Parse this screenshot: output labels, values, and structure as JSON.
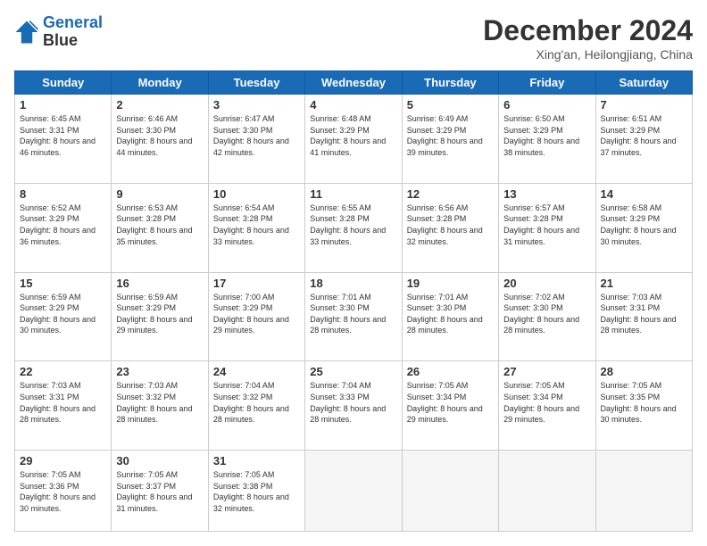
{
  "logo": {
    "line1": "General",
    "line2": "Blue"
  },
  "header": {
    "title": "December 2024",
    "subtitle": "Xing'an, Heilongjiang, China"
  },
  "weekdays": [
    "Sunday",
    "Monday",
    "Tuesday",
    "Wednesday",
    "Thursday",
    "Friday",
    "Saturday"
  ],
  "weeks": [
    [
      {
        "day": "1",
        "rise": "6:45 AM",
        "set": "3:31 PM",
        "daylight": "8 hours and 46 minutes."
      },
      {
        "day": "2",
        "rise": "6:46 AM",
        "set": "3:30 PM",
        "daylight": "8 hours and 44 minutes."
      },
      {
        "day": "3",
        "rise": "6:47 AM",
        "set": "3:30 PM",
        "daylight": "8 hours and 42 minutes."
      },
      {
        "day": "4",
        "rise": "6:48 AM",
        "set": "3:29 PM",
        "daylight": "8 hours and 41 minutes."
      },
      {
        "day": "5",
        "rise": "6:49 AM",
        "set": "3:29 PM",
        "daylight": "8 hours and 39 minutes."
      },
      {
        "day": "6",
        "rise": "6:50 AM",
        "set": "3:29 PM",
        "daylight": "8 hours and 38 minutes."
      },
      {
        "day": "7",
        "rise": "6:51 AM",
        "set": "3:29 PM",
        "daylight": "8 hours and 37 minutes."
      }
    ],
    [
      {
        "day": "8",
        "rise": "6:52 AM",
        "set": "3:29 PM",
        "daylight": "8 hours and 36 minutes."
      },
      {
        "day": "9",
        "rise": "6:53 AM",
        "set": "3:28 PM",
        "daylight": "8 hours and 35 minutes."
      },
      {
        "day": "10",
        "rise": "6:54 AM",
        "set": "3:28 PM",
        "daylight": "8 hours and 33 minutes."
      },
      {
        "day": "11",
        "rise": "6:55 AM",
        "set": "3:28 PM",
        "daylight": "8 hours and 33 minutes."
      },
      {
        "day": "12",
        "rise": "6:56 AM",
        "set": "3:28 PM",
        "daylight": "8 hours and 32 minutes."
      },
      {
        "day": "13",
        "rise": "6:57 AM",
        "set": "3:28 PM",
        "daylight": "8 hours and 31 minutes."
      },
      {
        "day": "14",
        "rise": "6:58 AM",
        "set": "3:29 PM",
        "daylight": "8 hours and 30 minutes."
      }
    ],
    [
      {
        "day": "15",
        "rise": "6:59 AM",
        "set": "3:29 PM",
        "daylight": "8 hours and 30 minutes."
      },
      {
        "day": "16",
        "rise": "6:59 AM",
        "set": "3:29 PM",
        "daylight": "8 hours and 29 minutes."
      },
      {
        "day": "17",
        "rise": "7:00 AM",
        "set": "3:29 PM",
        "daylight": "8 hours and 29 minutes."
      },
      {
        "day": "18",
        "rise": "7:01 AM",
        "set": "3:30 PM",
        "daylight": "8 hours and 28 minutes."
      },
      {
        "day": "19",
        "rise": "7:01 AM",
        "set": "3:30 PM",
        "daylight": "8 hours and 28 minutes."
      },
      {
        "day": "20",
        "rise": "7:02 AM",
        "set": "3:30 PM",
        "daylight": "8 hours and 28 minutes."
      },
      {
        "day": "21",
        "rise": "7:03 AM",
        "set": "3:31 PM",
        "daylight": "8 hours and 28 minutes."
      }
    ],
    [
      {
        "day": "22",
        "rise": "7:03 AM",
        "set": "3:31 PM",
        "daylight": "8 hours and 28 minutes."
      },
      {
        "day": "23",
        "rise": "7:03 AM",
        "set": "3:32 PM",
        "daylight": "8 hours and 28 minutes."
      },
      {
        "day": "24",
        "rise": "7:04 AM",
        "set": "3:32 PM",
        "daylight": "8 hours and 28 minutes."
      },
      {
        "day": "25",
        "rise": "7:04 AM",
        "set": "3:33 PM",
        "daylight": "8 hours and 28 minutes."
      },
      {
        "day": "26",
        "rise": "7:05 AM",
        "set": "3:34 PM",
        "daylight": "8 hours and 29 minutes."
      },
      {
        "day": "27",
        "rise": "7:05 AM",
        "set": "3:34 PM",
        "daylight": "8 hours and 29 minutes."
      },
      {
        "day": "28",
        "rise": "7:05 AM",
        "set": "3:35 PM",
        "daylight": "8 hours and 30 minutes."
      }
    ],
    [
      {
        "day": "29",
        "rise": "7:05 AM",
        "set": "3:36 PM",
        "daylight": "8 hours and 30 minutes."
      },
      {
        "day": "30",
        "rise": "7:05 AM",
        "set": "3:37 PM",
        "daylight": "8 hours and 31 minutes."
      },
      {
        "day": "31",
        "rise": "7:05 AM",
        "set": "3:38 PM",
        "daylight": "8 hours and 32 minutes."
      },
      null,
      null,
      null,
      null
    ]
  ]
}
